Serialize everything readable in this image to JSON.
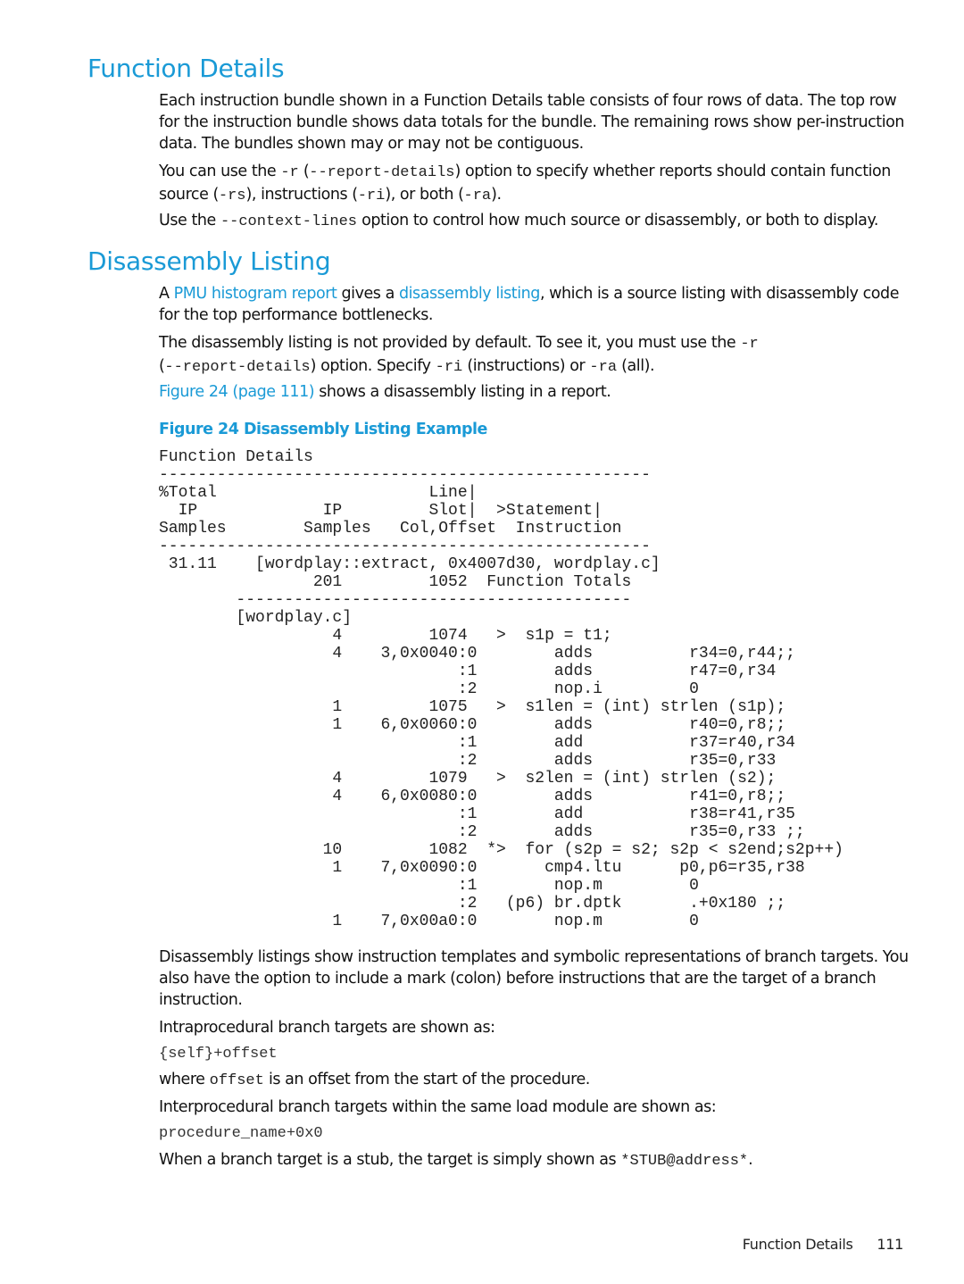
{
  "section1": {
    "title": "Function Details",
    "p1": "Each instruction bundle shown in a Function Details table consists of four rows of data. The top row for the instruction bundle shows data totals for the bundle. The remaining rows show per-instruction data. The bundles shown may or may not be contiguous.",
    "p2": {
      "t1": "You can use the ",
      "c1": "-r",
      "t2": " (",
      "c2": "--report-details",
      "t3": ") option to specify whether reports should contain function source (",
      "c3": "-rs",
      "t4": "), instructions (",
      "c4": "-ri",
      "t5": "), or both (",
      "c5": "-ra",
      "t6": ")."
    },
    "p3": {
      "t1": "Use the ",
      "c1": "--context-lines",
      "t2": " option to control how much source or disassembly, or both to display."
    }
  },
  "section2": {
    "title": "Disassembly Listing",
    "p1": {
      "t1": "A ",
      "link1": "PMU histogram report",
      "t2": " gives a ",
      "link2": "disassembly listing",
      "t3": ", which is a source listing with disassembly code for the top performance bottlenecks."
    },
    "p2": {
      "t1": "The disassembly listing is not provided by default. To see it, you must use the ",
      "c1": "-r",
      "t2": " (",
      "c2": "--report-details",
      "t3": ") option. Specify ",
      "c3": "-ri",
      "t4": " (instructions) or ",
      "c4": "-ra",
      "t5": " (all)."
    },
    "p3": {
      "link": "Figure 24 (page 111)",
      "t1": " shows a disassembly listing in a report."
    },
    "figure_caption": "Figure 24 Disassembly Listing Example",
    "listing": [
      "Function Details",
      "---------------------------------------------------",
      "%Total                      Line|",
      "  IP             IP         Slot|  >Statement|",
      "Samples        Samples   Col,Offset  Instruction",
      "---------------------------------------------------",
      " 31.11    [wordplay::extract, 0x4007d30, wordplay.c]",
      "                201         1052  Function Totals",
      "        -----------------------------------------",
      "        [wordplay.c]",
      "                  4         1074   >  s1p = t1;",
      "                  4    3,0x0040:0        adds          r34=0,r44;;",
      "                               :1        adds          r47=0,r34",
      "                               :2        nop.i         0",
      "                  1         1075   >  s1len = (int) strlen (s1p);",
      "                  1    6,0x0060:0        adds          r40=0,r8;;",
      "                               :1        add           r37=r40,r34",
      "                               :2        adds          r35=0,r33",
      "                  4         1079   >  s2len = (int) strlen (s2);",
      "                  4    6,0x0080:0        adds          r41=0,r8;;",
      "                               :1        add           r38=r41,r35",
      "                               :2        adds          r35=0,r33 ;;",
      "                 10         1082  *>  for (s2p = s2; s2p < s2end;s2p++)",
      "                  1    7,0x0090:0       cmp4.ltu      p0,p6=r35,r38",
      "                               :1        nop.m         0",
      "                               :2   (p6) br.dptk       .+0x180 ;;",
      "                  1    7,0x00a0:0        nop.m         0"
    ],
    "p4": "Disassembly listings show instruction templates and symbolic representations of branch targets. You also have the option to include a mark (colon) before instructions that are the target of a branch instruction.",
    "p5": "Intraprocedural branch targets are shown as:",
    "code1": "{self}+offset",
    "p6": {
      "t1": "where ",
      "c1": "offset",
      "t2": " is an offset from the start of the procedure."
    },
    "p7": "Interprocedural branch targets within the same load module are shown as:",
    "code2": "procedure_name+0x0",
    "p8": {
      "t1": "When a branch target is a stub, the target is simply shown as ",
      "c1": "*STUB@address*",
      "t2": "."
    }
  },
  "footer": {
    "section": "Function Details",
    "page": "111"
  },
  "colors": {
    "accent": "#1a9ad6",
    "text": "#111111"
  }
}
